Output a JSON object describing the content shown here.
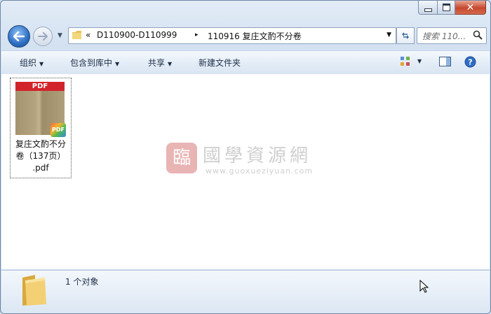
{
  "window": {
    "caption_close": "✕"
  },
  "nav": {
    "address_prefix": "«",
    "address_segments": [
      "D110900-D110999",
      "110916 复庄文酌不分卷"
    ],
    "address_separator": "▸",
    "search_placeholder": "搜索 110..."
  },
  "toolbar": {
    "organize": "组织",
    "include_in_library": "包含到库中",
    "share": "共享",
    "new_folder": "新建文件夹"
  },
  "file": {
    "thumb_label": "PDF",
    "badge_label": "PDF",
    "name_lines": [
      "复庄文酌不分",
      "卷（137页）",
      ".pdf"
    ]
  },
  "watermark": {
    "seal": "臨",
    "title": "國學資源網",
    "url": "www.guoxueziyuan.com"
  },
  "status": {
    "count_text": "1 个对象"
  },
  "colors": {
    "accent": "#2d6fc3",
    "close_button": "#c6472f",
    "pdf_red": "#d2232a"
  }
}
